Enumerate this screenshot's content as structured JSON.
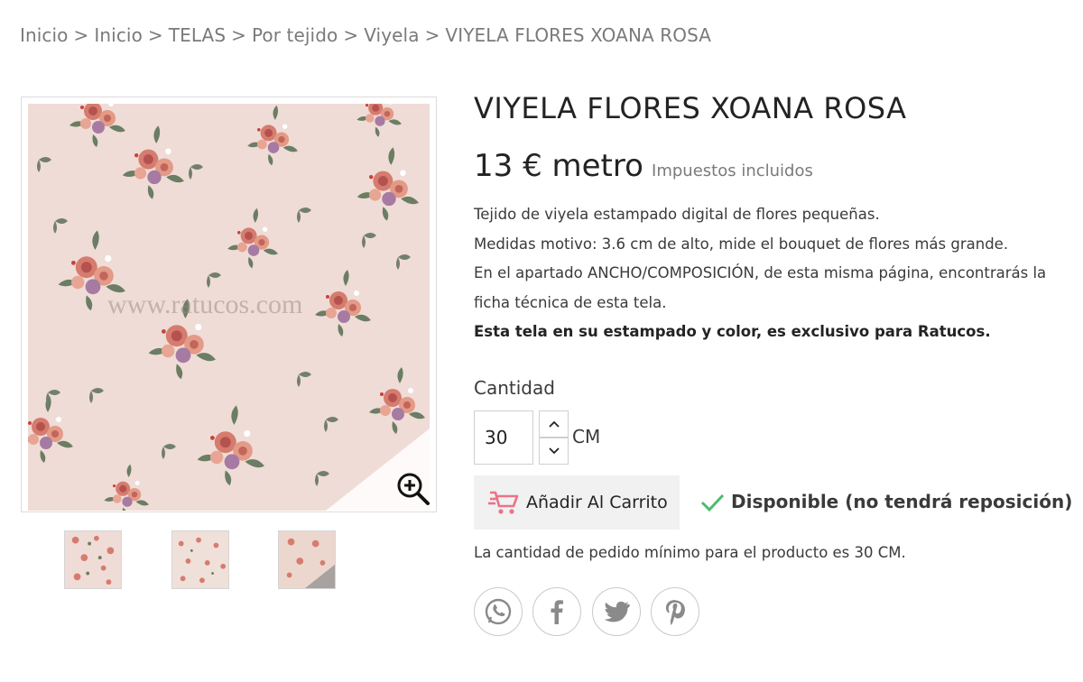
{
  "breadcrumb": {
    "items": [
      "Inicio",
      "Inicio",
      "TELAS",
      "Por tejido",
      "Viyela",
      "VIYELA FLORES XOANA ROSA"
    ],
    "separator": ">"
  },
  "product": {
    "title": "VIYELA FLORES XOANA ROSA",
    "price": "13 € metro",
    "tax_note": "Impuestos incluidos",
    "description": [
      "Tejido de viyela estampado digital de flores pequeñas.",
      "Medidas motivo: 3.6 cm de alto, mide el bouquet de flores más grande.",
      "En el apartado ANCHO/COMPOSICIÓN, de esta misma página, encontrarás la ficha técnica de esta tela."
    ],
    "exclusive_note": "Esta tela en su estampado y color, es exclusivo para Ratucos.",
    "image_watermark": "www.ratucos.com"
  },
  "quantity": {
    "label": "Cantidad",
    "value": "30",
    "unit": "CM"
  },
  "actions": {
    "add_to_cart": "Añadir Al Carrito"
  },
  "availability": {
    "text": "Disponible (no tendrá reposición)",
    "color": "#4cbb6c"
  },
  "min_order": "La cantidad de pedido mínimo para el producto es 30 CM.",
  "share": {
    "icons": [
      "whatsapp-icon",
      "facebook-icon",
      "twitter-icon",
      "pinterest-icon"
    ]
  },
  "colors": {
    "fabric_background": "#efdcd6",
    "cart_icon": "#e8748a",
    "text": "#232323",
    "muted": "#7a7a7a"
  },
  "thumbnails": [
    "thumb-1",
    "thumb-2",
    "thumb-3"
  ]
}
